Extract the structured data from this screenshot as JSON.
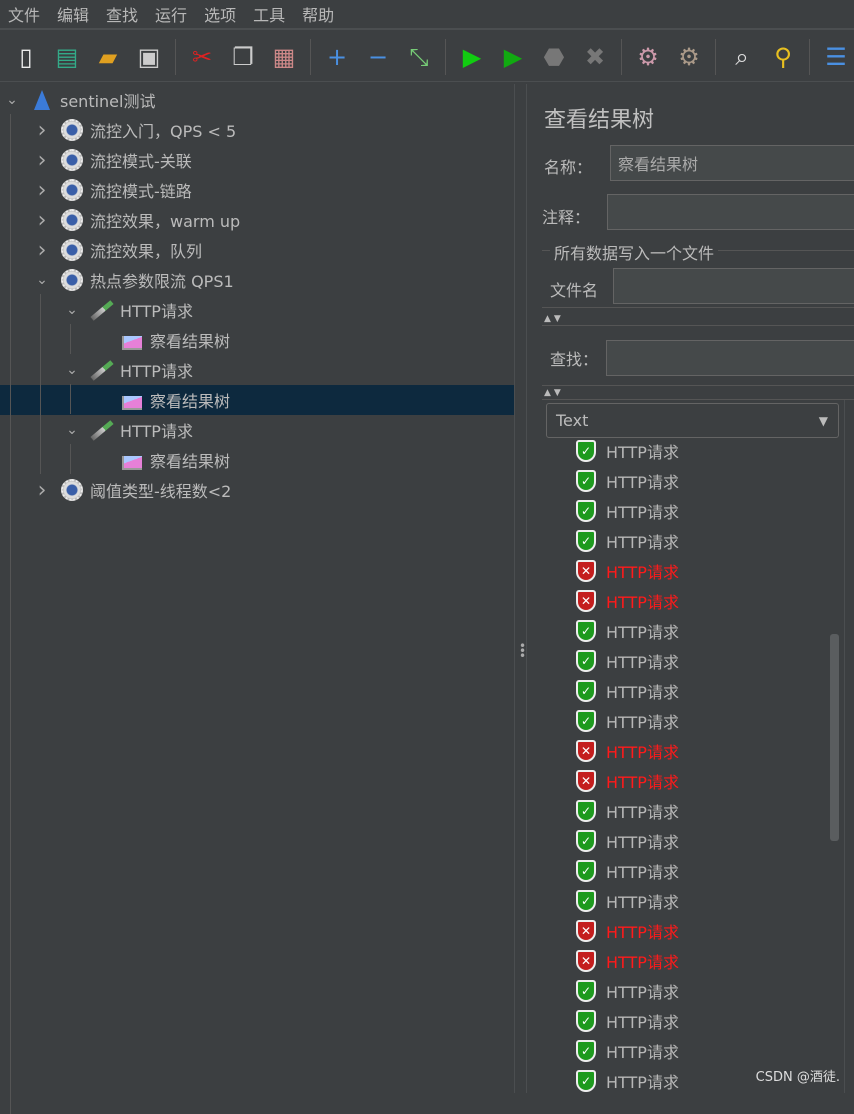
{
  "menu": [
    "文件",
    "编辑",
    "查找",
    "运行",
    "选项",
    "工具",
    "帮助"
  ],
  "toolbar": [
    {
      "icon": "new-icon",
      "glyph": "▯",
      "color": "#eee"
    },
    {
      "icon": "templates-icon",
      "glyph": "▤",
      "color": "#3a8"
    },
    {
      "icon": "open-icon",
      "glyph": "▰",
      "color": "#e0a020"
    },
    {
      "icon": "save-icon",
      "glyph": "▣",
      "color": "#ccc"
    },
    {
      "sep": true
    },
    {
      "icon": "cut-icon",
      "glyph": "✂",
      "color": "#d22"
    },
    {
      "icon": "copy-icon",
      "glyph": "❐",
      "color": "#ccc"
    },
    {
      "icon": "paste-icon",
      "glyph": "▦",
      "color": "#c88"
    },
    {
      "sep": true
    },
    {
      "icon": "expand-icon",
      "glyph": "+",
      "color": "#4a90e2"
    },
    {
      "icon": "collapse-icon",
      "glyph": "−",
      "color": "#4a90e2"
    },
    {
      "icon": "toggle-icon",
      "glyph": "⤡",
      "color": "#7c7"
    },
    {
      "sep": true
    },
    {
      "icon": "start-icon",
      "glyph": "▶",
      "color": "#1c1"
    },
    {
      "icon": "start-no-pause-icon",
      "glyph": "▶",
      "color": "#1a1"
    },
    {
      "icon": "stop-icon",
      "glyph": "⬣",
      "color": "#777"
    },
    {
      "icon": "shutdown-icon",
      "glyph": "✖",
      "color": "#777"
    },
    {
      "sep": true
    },
    {
      "icon": "clear-icon",
      "glyph": "⚙",
      "color": "#c9a"
    },
    {
      "icon": "clear-all-icon",
      "glyph": "⚙",
      "color": "#a98"
    },
    {
      "sep": true
    },
    {
      "icon": "search-icon",
      "glyph": "⌕",
      "color": "#ddd"
    },
    {
      "icon": "reset-search-icon",
      "glyph": "⚲",
      "color": "#e8c020"
    },
    {
      "sep": true
    },
    {
      "icon": "function-helper-icon",
      "glyph": "☰",
      "color": "#4a90e2"
    }
  ],
  "tree": [
    {
      "label": "sentinel测试",
      "depth": 0,
      "icon": "test-plan-icon",
      "state": "open"
    },
    {
      "label": "流控入门，QPS < 5",
      "depth": 1,
      "icon": "thread-group-icon",
      "state": "closed"
    },
    {
      "label": "流控模式-关联",
      "depth": 1,
      "icon": "thread-group-icon",
      "state": "closed"
    },
    {
      "label": "流控模式-链路",
      "depth": 1,
      "icon": "thread-group-icon",
      "state": "closed"
    },
    {
      "label": "流控效果，warm up",
      "depth": 1,
      "icon": "thread-group-icon",
      "state": "closed"
    },
    {
      "label": "流控效果，队列",
      "depth": 1,
      "icon": "thread-group-icon",
      "state": "closed"
    },
    {
      "label": "热点参数限流 QPS1",
      "depth": 1,
      "icon": "thread-group-icon",
      "state": "open"
    },
    {
      "label": "HTTP请求",
      "depth": 2,
      "icon": "http-sampler-icon",
      "state": "open"
    },
    {
      "label": "察看结果树",
      "depth": 3,
      "icon": "listener-icon",
      "state": "leaf"
    },
    {
      "label": "HTTP请求",
      "depth": 2,
      "icon": "http-sampler-icon",
      "state": "open"
    },
    {
      "label": "察看结果树",
      "depth": 3,
      "icon": "listener-icon",
      "state": "leaf",
      "selected": true
    },
    {
      "label": "HTTP请求",
      "depth": 2,
      "icon": "http-sampler-icon",
      "state": "open"
    },
    {
      "label": "察看结果树",
      "depth": 3,
      "icon": "listener-icon",
      "state": "leaf"
    },
    {
      "label": "阈值类型-线程数<2",
      "depth": 1,
      "icon": "thread-group-icon",
      "state": "closed"
    }
  ],
  "panel": {
    "title": "查看结果树",
    "name_label": "名称：",
    "name_value": "察看结果树",
    "comment_label": "注释：",
    "comment_value": "",
    "file_section": "所有数据写入一个文件",
    "file_label": "文件名",
    "file_value": "",
    "search_label": "查找：",
    "search_value": "",
    "renderer": "Text"
  },
  "results": [
    {
      "label": "HTTP请求",
      "status": "ok"
    },
    {
      "label": "HTTP请求",
      "status": "ok"
    },
    {
      "label": "HTTP请求",
      "status": "ok"
    },
    {
      "label": "HTTP请求",
      "status": "ok"
    },
    {
      "label": "HTTP请求",
      "status": "err"
    },
    {
      "label": "HTTP请求",
      "status": "err"
    },
    {
      "label": "HTTP请求",
      "status": "ok"
    },
    {
      "label": "HTTP请求",
      "status": "ok"
    },
    {
      "label": "HTTP请求",
      "status": "ok"
    },
    {
      "label": "HTTP请求",
      "status": "ok"
    },
    {
      "label": "HTTP请求",
      "status": "err"
    },
    {
      "label": "HTTP请求",
      "status": "err"
    },
    {
      "label": "HTTP请求",
      "status": "ok"
    },
    {
      "label": "HTTP请求",
      "status": "ok"
    },
    {
      "label": "HTTP请求",
      "status": "ok"
    },
    {
      "label": "HTTP请求",
      "status": "ok"
    },
    {
      "label": "HTTP请求",
      "status": "err"
    },
    {
      "label": "HTTP请求",
      "status": "err"
    },
    {
      "label": "HTTP请求",
      "status": "ok"
    },
    {
      "label": "HTTP请求",
      "status": "ok"
    },
    {
      "label": "HTTP请求",
      "status": "ok"
    },
    {
      "label": "HTTP请求",
      "status": "ok"
    }
  ],
  "colors": {
    "background": "#3c3f41",
    "selection": "#0d293e",
    "success": "#1d9a1d",
    "error": "#ff1a1a"
  },
  "watermark": "CSDN @酒徒."
}
